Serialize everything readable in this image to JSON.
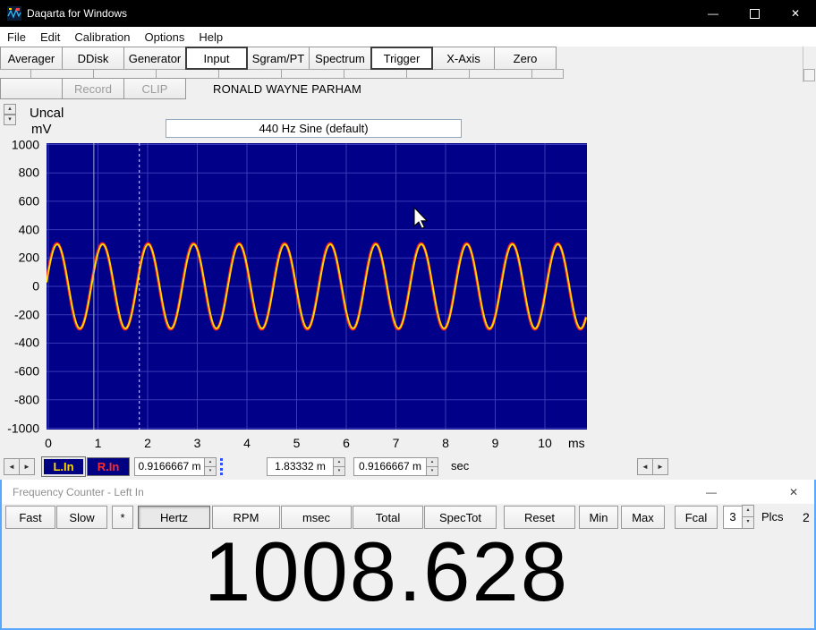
{
  "main": {
    "title": "Daqarta for Windows",
    "menu": [
      "File",
      "Edit",
      "Calibration",
      "Options",
      "Help"
    ],
    "toolbar": [
      "Averager",
      "DDisk",
      "Generator",
      "Input",
      "Sgram/PT",
      "Spectrum",
      "Trigger",
      "X-Axis",
      "Zero"
    ],
    "record_label": "Record",
    "clip_label": "CLIP",
    "user_name": "RONALD WAYNE PARHAM",
    "uncal_label": "Uncal",
    "y_unit": "mV",
    "generator_title": "440 Hz Sine (default)"
  },
  "chart_data": {
    "type": "line",
    "title": "440 Hz Sine (default)",
    "x_ticks": [
      0,
      1,
      2,
      3,
      4,
      5,
      6,
      7,
      8,
      9,
      10
    ],
    "x_unit": "ms",
    "y_ticks": [
      1000,
      800,
      600,
      400,
      200,
      0,
      -200,
      -400,
      -600,
      -800,
      -1000
    ],
    "y_unit": "mV",
    "ylim": [
      -1000,
      1000
    ],
    "x_visible_ms": 10.85,
    "grid": "on",
    "amplitude_mV": 300,
    "period_ms": 0.9166667,
    "phase_rad": 0.34,
    "solid_cursor_ms": 0.9166667,
    "dashed_cursor_ms": 1.83332,
    "series": [
      {
        "name": "L.In",
        "shape": "sine",
        "amplitude_mV": 300,
        "color": "#ffe000"
      },
      {
        "name": "R.In",
        "shape": "sine",
        "amplitude_mV": 306,
        "color": "#ff2020"
      }
    ],
    "colors": {
      "background": "#000088",
      "grid": "#3a3ab8",
      "cursor_solid": "#9aa8c8",
      "cursor_dashed": "#e6e6f6"
    }
  },
  "bottom": {
    "left_channel": "L.In",
    "right_channel": "R.In",
    "cursor_left": "0.9166667 m",
    "cursor_right": "1.83332 m",
    "cursor_delta": "0.9166667 m",
    "unit": "sec"
  },
  "counter": {
    "title": "Frequency Counter - Left In",
    "buttons": [
      "Fast",
      "Slow",
      "*",
      "Hertz",
      "RPM",
      "msec",
      "Total",
      "SpecTot",
      "Reset",
      "Min",
      "Max",
      "Fcal"
    ],
    "places_value": "3",
    "places_label": "Plcs",
    "edge_value": "2",
    "reading": "1008.628"
  },
  "icons": {
    "minimize": "—",
    "close": "✕",
    "left_arrow": "◄",
    "right_arrow": "►",
    "up_small": "▴",
    "down_small": "▾"
  }
}
